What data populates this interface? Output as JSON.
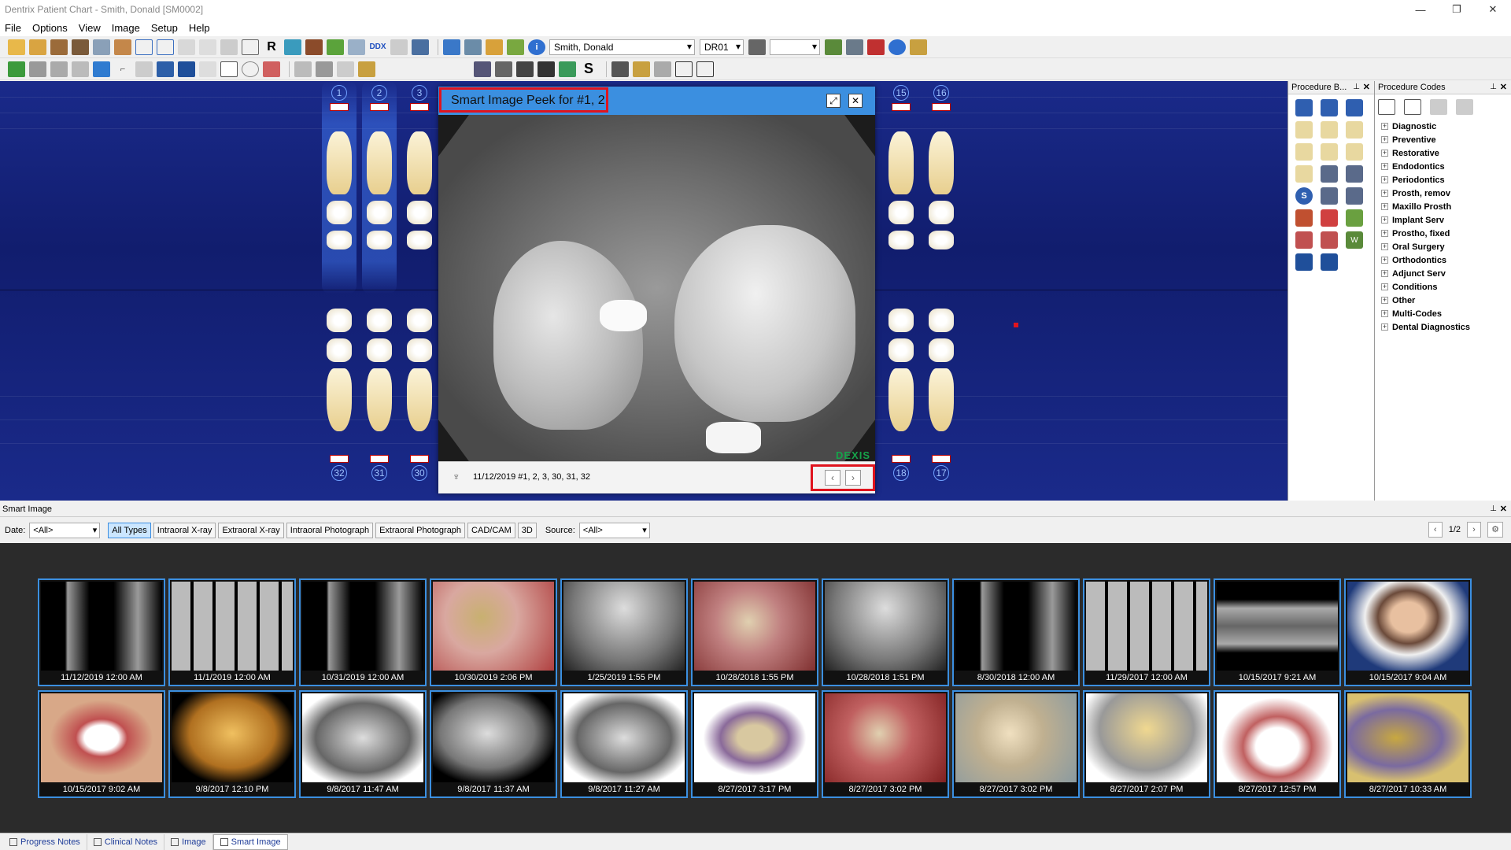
{
  "window": {
    "title": "Dentrix Patient Chart - Smith, Donald [SM0002]",
    "minimize": "—",
    "restore": "❐",
    "close": "✕"
  },
  "menu": [
    "File",
    "Options",
    "View",
    "Image",
    "Setup",
    "Help"
  ],
  "toolbar": {
    "patient": "Smith, Donald",
    "provider": "DR01",
    "ddx_label": "DDX",
    "r_label": "R",
    "s_label": "S"
  },
  "chart": {
    "upper_numbers": [
      "1",
      "2",
      "3",
      "15",
      "16"
    ],
    "lower_numbers": [
      "32",
      "31",
      "30",
      "18",
      "17"
    ],
    "selected_teeth": [
      "1",
      "2"
    ]
  },
  "peek": {
    "title": "Smart Image Peek for #1, 2",
    "expand_icon": "⤢",
    "close_icon": "✕",
    "caption": "11/12/2019 #1, 2, 3, 30, 31, 32",
    "watermark": "DEXIS",
    "prev": "‹",
    "next": "›"
  },
  "procedure_buttons": {
    "title": "Procedure B...",
    "pin": "⊥",
    "close": "✕"
  },
  "procedure_codes": {
    "title": "Procedure Codes",
    "pin": "⊥",
    "close": "✕",
    "items": [
      "Diagnostic",
      "Preventive",
      "Restorative",
      "Endodontics",
      "Periodontics",
      "Prosth, remov",
      "Maxillo Prosth",
      "Implant Serv",
      "Prostho, fixed",
      "Oral Surgery",
      "Orthodontics",
      "Adjunct Serv",
      "Conditions",
      "Other",
      "Multi-Codes",
      "Dental Diagnostics"
    ]
  },
  "smart_image": {
    "title": "Smart Image",
    "pin": "⊥",
    "close": "✕",
    "date_label": "Date:",
    "date_value": "<All>",
    "types": [
      "All Types",
      "Intraoral X-ray",
      "Extraoral X-ray",
      "Intraoral Photograph",
      "Extraoral Photograph",
      "CAD/CAM",
      "3D"
    ],
    "active_type": "All Types",
    "source_label": "Source:",
    "source_value": "<All>",
    "page": "1/2",
    "prev": "‹",
    "next": "›",
    "settings_icon": "⚙",
    "thumbs": [
      "11/12/2019 12:00 AM",
      "11/1/2019 12:00 AM",
      "10/31/2019 12:00 AM",
      "10/30/2019 2:06 PM",
      "1/25/2019 1:55 PM",
      "10/28/2018 1:55 PM",
      "10/28/2018 1:51 PM",
      "8/30/2018 12:00 AM",
      "11/29/2017 12:00 AM",
      "10/15/2017 9:21 AM",
      "10/15/2017 9:04 AM",
      "10/15/2017 9:02 AM",
      "9/8/2017 12:10 PM",
      "9/8/2017 11:47 AM",
      "9/8/2017 11:37 AM",
      "9/8/2017 11:27 AM",
      "8/27/2017 3:17 PM",
      "8/27/2017 3:02 PM",
      "8/27/2017 3:02 PM",
      "8/27/2017 2:07 PM",
      "8/27/2017 12:57 PM",
      "8/27/2017 10:33 AM"
    ]
  },
  "tabs": [
    "Progress Notes",
    "Clinical Notes",
    "Image",
    "Smart Image"
  ],
  "active_tab": "Smart Image"
}
